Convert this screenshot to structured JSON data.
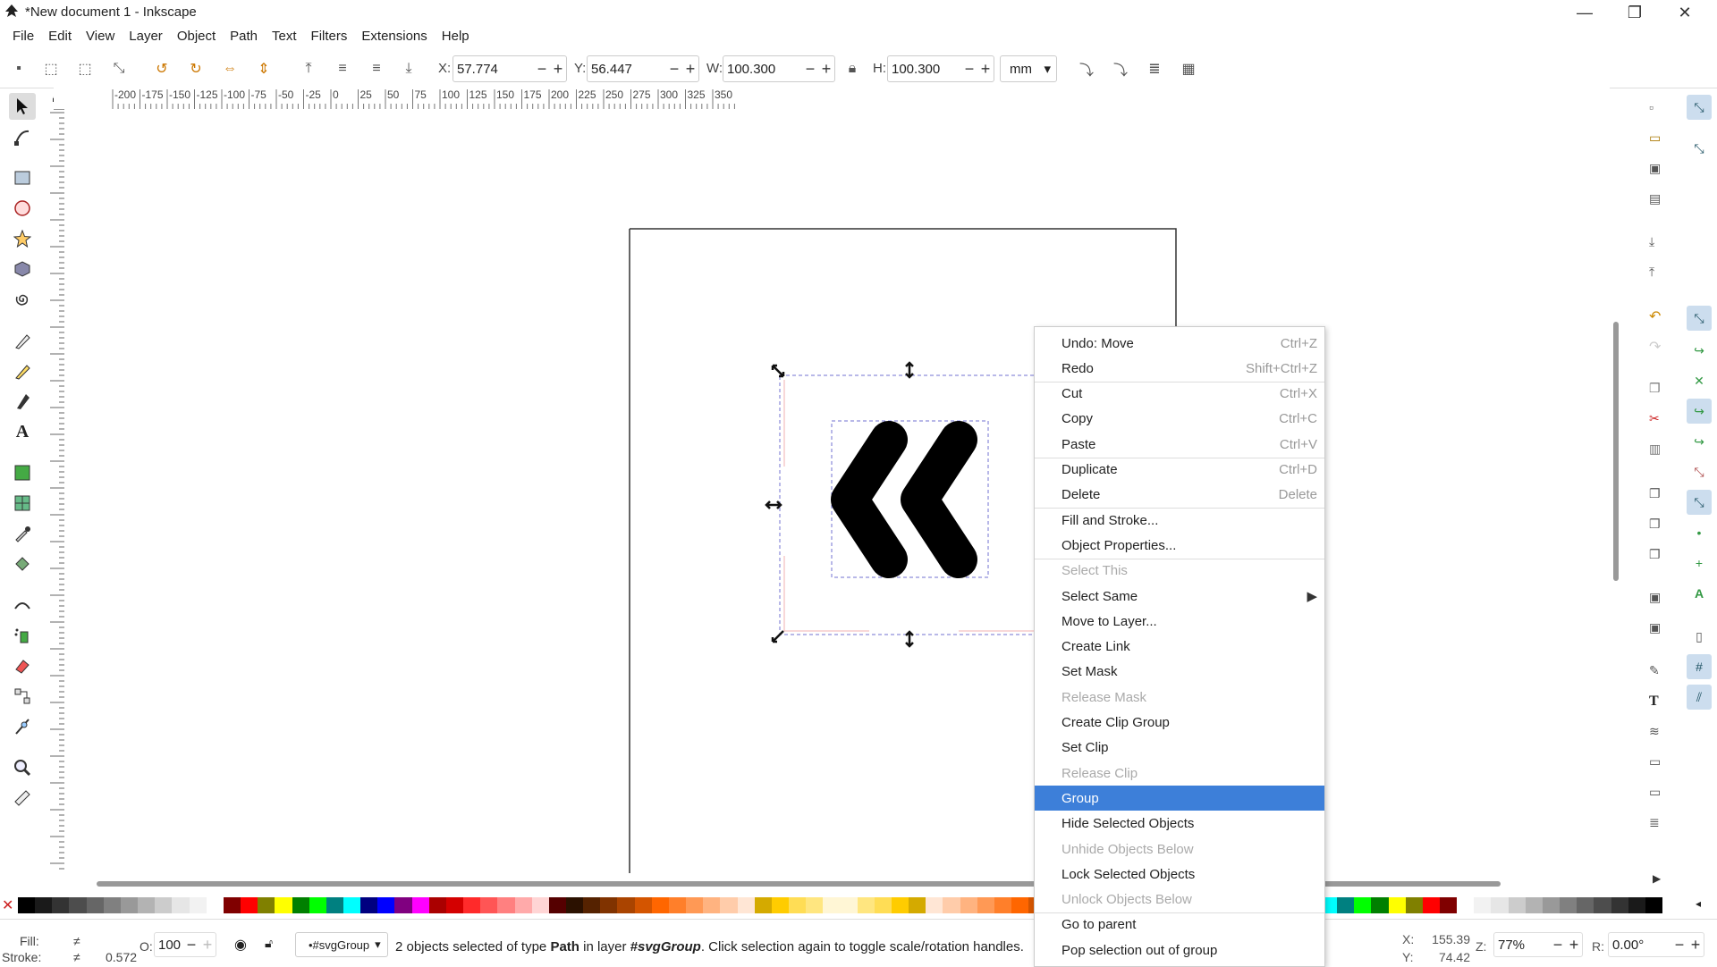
{
  "window": {
    "title": "*New document 1 - Inkscape",
    "minimize": "—",
    "maximize": "❐",
    "close": "✕"
  },
  "menu": [
    "File",
    "Edit",
    "View",
    "Layer",
    "Object",
    "Path",
    "Text",
    "Filters",
    "Extensions",
    "Help"
  ],
  "toolbar": {
    "x_label": "X:",
    "x_value": "57.774",
    "y_label": "Y:",
    "y_value": "56.447",
    "w_label": "W:",
    "w_value": "100.300",
    "h_label": "H:",
    "h_value": "100.300",
    "unit": "mm",
    "minus": "−",
    "plus": "+"
  },
  "ruler_labels": [
    "-200",
    "-175",
    "-150",
    "-125",
    "-100",
    "-75",
    "-50",
    "-25",
    "0",
    "25",
    "50",
    "75",
    "100",
    "125",
    "150",
    "175",
    "200",
    "225",
    "250",
    "275",
    "300",
    "325",
    "350"
  ],
  "context_menu": {
    "items": [
      {
        "label": "Undo: Move",
        "shortcut": "Ctrl+Z",
        "disabled": false
      },
      {
        "label": "Redo",
        "shortcut": "Shift+Ctrl+Z",
        "disabled": false
      },
      {
        "label": "Cut",
        "shortcut": "Ctrl+X",
        "disabled": false
      },
      {
        "label": "Copy",
        "shortcut": "Ctrl+C",
        "disabled": false
      },
      {
        "label": "Paste",
        "shortcut": "Ctrl+V",
        "disabled": false
      },
      {
        "label": "Duplicate",
        "shortcut": "Ctrl+D",
        "disabled": false
      },
      {
        "label": "Delete",
        "shortcut": "Delete",
        "disabled": false
      },
      {
        "label": "Fill and Stroke...",
        "shortcut": "",
        "disabled": false
      },
      {
        "label": "Object Properties...",
        "shortcut": "",
        "disabled": false
      },
      {
        "label": "Select This",
        "shortcut": "",
        "disabled": true
      },
      {
        "label": "Select Same",
        "shortcut": "▶",
        "disabled": false
      },
      {
        "label": "Move to Layer...",
        "shortcut": "",
        "disabled": false
      },
      {
        "label": "Create Link",
        "shortcut": "",
        "disabled": false
      },
      {
        "label": "Set Mask",
        "shortcut": "",
        "disabled": false
      },
      {
        "label": "Release Mask",
        "shortcut": "",
        "disabled": true
      },
      {
        "label": "Create Clip Group",
        "shortcut": "",
        "disabled": false
      },
      {
        "label": "Set Clip",
        "shortcut": "",
        "disabled": false
      },
      {
        "label": "Release Clip",
        "shortcut": "",
        "disabled": true
      },
      {
        "label": "Group",
        "shortcut": "",
        "disabled": false,
        "selected": true
      },
      {
        "label": "Hide Selected Objects",
        "shortcut": "",
        "disabled": false
      },
      {
        "label": "Unhide Objects Below",
        "shortcut": "",
        "disabled": true
      },
      {
        "label": "Lock Selected Objects",
        "shortcut": "",
        "disabled": false
      },
      {
        "label": "Unlock Objects Below",
        "shortcut": "",
        "disabled": true
      },
      {
        "label": "Go to parent",
        "shortcut": "",
        "disabled": false
      },
      {
        "label": "Pop selection out of group",
        "shortcut": "",
        "disabled": false
      }
    ]
  },
  "status": {
    "fill_label": "Fill:",
    "fill_value": "≠",
    "stroke_label": "Stroke:",
    "stroke_value": "≠",
    "stroke_width": "0.572",
    "opacity_label": "O:",
    "opacity_value": "100",
    "layer": "•#svgGroup",
    "message_pre": "2 objects selected of type ",
    "message_type": "Path",
    "message_mid": " in layer ",
    "message_layer": "#svgGroup",
    "message_post": ". Click selection again to toggle scale/rotation handles.",
    "x_label": "X:",
    "x_coord": "155.39",
    "y_label": "Y:",
    "y_coord": "74.42",
    "zoom_label": "Z:",
    "zoom_value": "77%",
    "rotate_label": "R:",
    "rotate_value": "0.00°"
  },
  "palette_colors": [
    "#000000",
    "#1a1a1a",
    "#333333",
    "#4d4d4d",
    "#666666",
    "#808080",
    "#999999",
    "#b3b3b3",
    "#cccccc",
    "#e6e6e6",
    "#f2f2f2",
    "#ffffff",
    "#800000",
    "#ff0000",
    "#808000",
    "#ffff00",
    "#008000",
    "#00ff00",
    "#008080",
    "#00ffff",
    "#000080",
    "#0000ff",
    "#800080",
    "#ff00ff",
    "#aa0000",
    "#d40000",
    "#ff2a2a",
    "#ff5555",
    "#ff8080",
    "#ffaaaa",
    "#ffd5d5",
    "#550000",
    "#2b1100",
    "#552200",
    "#803300",
    "#aa4400",
    "#d45500",
    "#ff6600",
    "#ff7f2a",
    "#ff9955",
    "#ffb380",
    "#ffccaa",
    "#ffe6d5",
    "#d4aa00",
    "#ffcc00",
    "#ffdd55",
    "#ffe680",
    "#fff6d5"
  ]
}
